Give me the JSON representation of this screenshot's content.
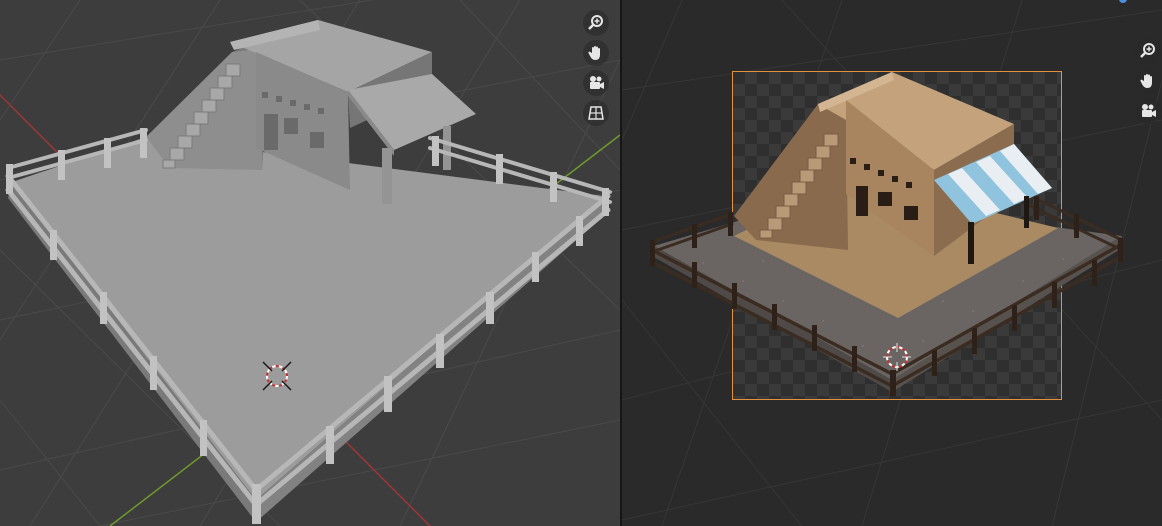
{
  "viewports": {
    "left": {
      "shading": "solid",
      "background_color": "#3d3d3d",
      "model_color": "#9a9a9a"
    },
    "right": {
      "shading": "rendered",
      "background_color": "#2a2a2a",
      "camera_frame_color": "#e3913c"
    }
  },
  "navigation_gizmo": {
    "left": [
      "zoom-icon",
      "hand-pan-icon",
      "camera-view-icon",
      "grid-ortho-icon"
    ],
    "right": [
      "zoom-icon",
      "hand-pan-icon",
      "camera-view-icon"
    ]
  },
  "colors": {
    "x_axis": "#9e3636",
    "y_axis": "#6f9a2c",
    "grid": "#4a4a4a",
    "awning_stripe_a": "#8fc3de",
    "awning_stripe_b": "#e8eef2",
    "adobe_wall": "#b48a62",
    "dirt": "#a98a63",
    "gravel": "#6a6563",
    "fence_wood": "#3b2c22"
  }
}
